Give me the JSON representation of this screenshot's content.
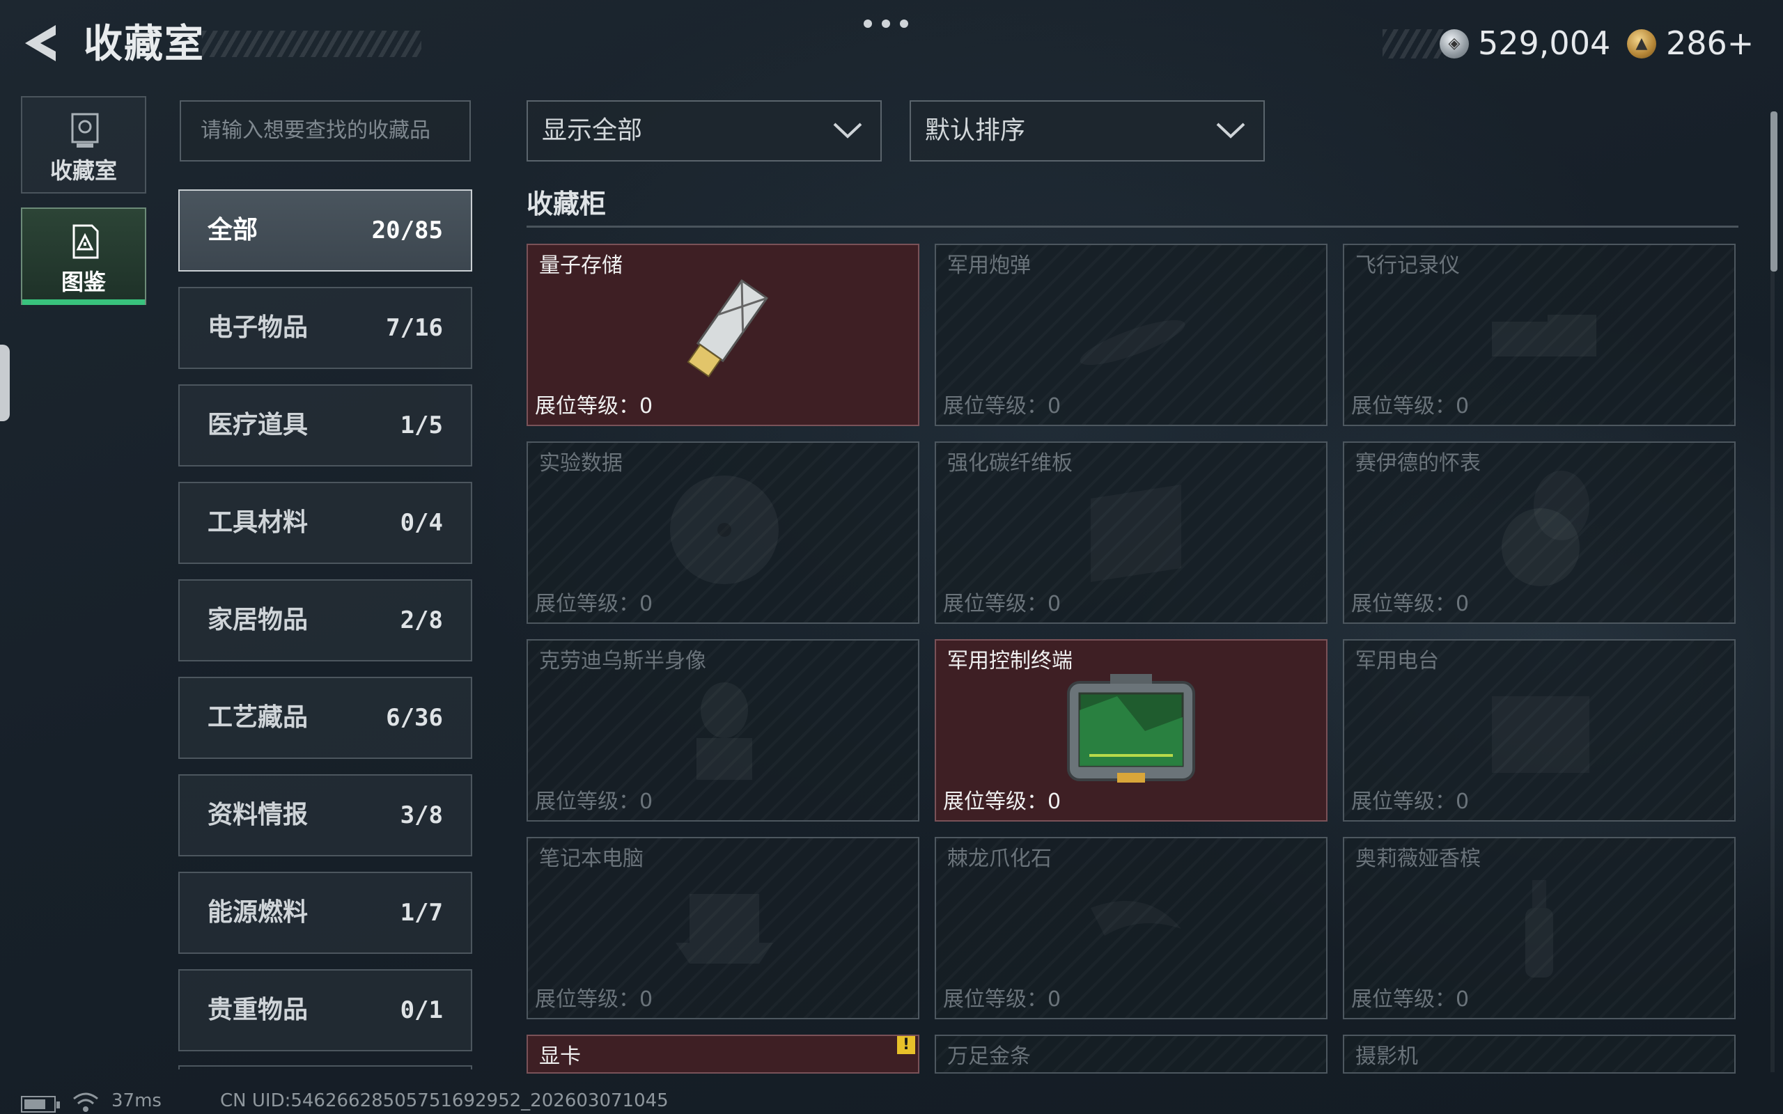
{
  "header": {
    "title": "收藏室",
    "currency_silver": "529,004",
    "currency_gold": "286+"
  },
  "nav": [
    {
      "label": "收藏室",
      "icon": "trophy-icon",
      "active": false
    },
    {
      "label": "图鉴",
      "icon": "catalog-icon",
      "active": true
    }
  ],
  "search": {
    "placeholder": "请输入想要查找的收藏品"
  },
  "categories": [
    {
      "name": "全部",
      "count": "20/85",
      "active": true
    },
    {
      "name": "电子物品",
      "count": "7/16"
    },
    {
      "name": "医疗道具",
      "count": "1/5"
    },
    {
      "name": "工具材料",
      "count": "0/4"
    },
    {
      "name": "家居物品",
      "count": "2/8"
    },
    {
      "name": "工艺藏品",
      "count": "6/36"
    },
    {
      "name": "资料情报",
      "count": "3/8"
    },
    {
      "name": "能源燃料",
      "count": "1/7"
    },
    {
      "name": "贵重物品",
      "count": "0/1"
    }
  ],
  "filters": {
    "display": "显示全部",
    "sort": "默认排序"
  },
  "section_title": "收藏柜",
  "level_label": "展位等级：",
  "items": [
    {
      "name": "量子存储",
      "level": "0",
      "owned": true,
      "icon": "usb-drive-icon"
    },
    {
      "name": "军用炮弹",
      "level": "0",
      "owned": false,
      "icon": "shell-icon"
    },
    {
      "name": "飞行记录仪",
      "level": "0",
      "owned": false,
      "icon": "flight-recorder-icon"
    },
    {
      "name": "实验数据",
      "level": "0",
      "owned": false,
      "icon": "disc-icon"
    },
    {
      "name": "强化碳纤维板",
      "level": "0",
      "owned": false,
      "icon": "carbon-plate-icon"
    },
    {
      "name": "赛伊德的怀表",
      "level": "0",
      "owned": false,
      "icon": "pocket-watch-icon"
    },
    {
      "name": "克劳迪乌斯半身像",
      "level": "0",
      "owned": false,
      "icon": "bust-icon"
    },
    {
      "name": "军用控制终端",
      "level": "0",
      "owned": true,
      "icon": "control-terminal-icon"
    },
    {
      "name": "军用电台",
      "level": "0",
      "owned": false,
      "icon": "radio-icon"
    },
    {
      "name": "笔记本电脑",
      "level": "0",
      "owned": false,
      "icon": "laptop-icon"
    },
    {
      "name": "棘龙爪化石",
      "level": "0",
      "owned": false,
      "icon": "fossil-claw-icon"
    },
    {
      "name": "奥莉薇娅香槟",
      "level": "0",
      "owned": false,
      "icon": "champagne-icon"
    },
    {
      "name": "显卡",
      "owned": true,
      "warning": "!",
      "icon": "gpu-icon"
    },
    {
      "name": "万足金条",
      "owned": false,
      "icon": "gold-bar-icon"
    },
    {
      "name": "摄影机",
      "owned": false,
      "icon": "camera-icon"
    }
  ],
  "status": {
    "ping": "37ms",
    "uid": "CN UID:5462662850575169295​2_202603071045"
  }
}
